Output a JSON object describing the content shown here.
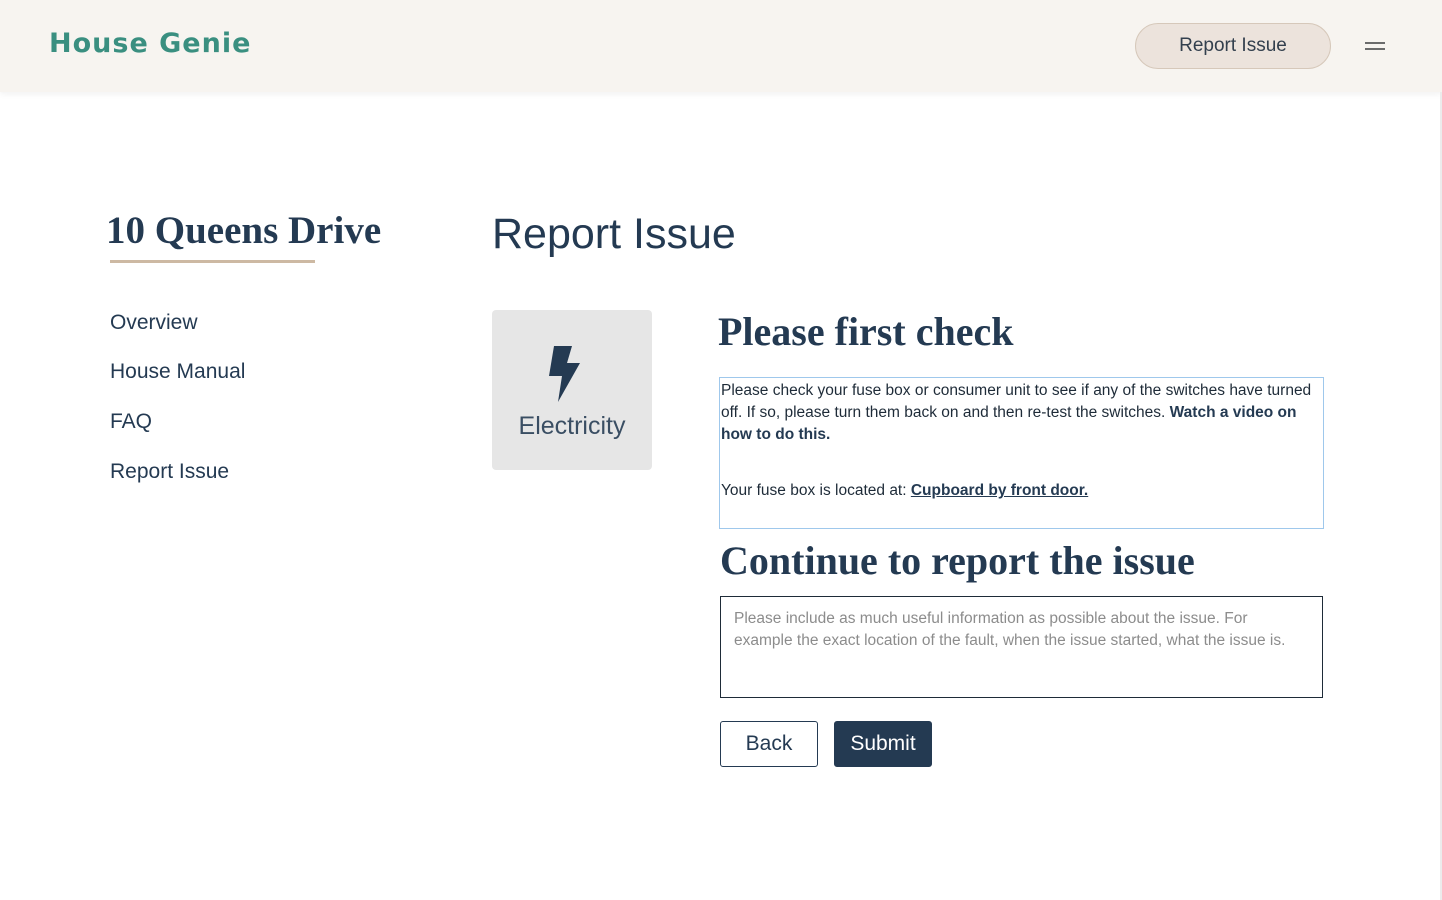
{
  "header": {
    "logo_text": "House Genie",
    "report_button_label": "Report Issue",
    "menu_icon": "hamburger-menu-icon"
  },
  "sidebar": {
    "property_name": "10 Queens Drive",
    "items": [
      {
        "label": "Overview"
      },
      {
        "label": "House Manual"
      },
      {
        "label": "FAQ"
      },
      {
        "label": "Report Issue"
      }
    ]
  },
  "main": {
    "heading": "Report Issue",
    "category": {
      "label": "Electricity",
      "icon": "lightning-bolt-icon"
    },
    "first_check": {
      "heading": "Please first check",
      "body_text": "Please check your fuse box or consumer unit to see if any of the switches have turned off. If so, please turn them back on and then re-test the switches.",
      "video_link": "Watch a video on how to do this.",
      "location_prefix": "Your fuse box is located at:",
      "location_value": "Cupboard by front door."
    },
    "report": {
      "heading": "Continue to report the issue",
      "textarea_value": "",
      "textarea_placeholder": "Please include as much useful information as possible about the issue. For example the exact location of the fault, when the issue started, what the issue is."
    },
    "buttons": {
      "back_label": "Back",
      "submit_label": "Submit"
    }
  },
  "colors": {
    "navy": "#243a52",
    "logo_teal": "#3a8f80",
    "header_bg": "#f7f4f0",
    "accent_tan": "#cdb9a3",
    "card_bg": "#e6e6e6",
    "focus_blue": "#9fc8ec"
  }
}
